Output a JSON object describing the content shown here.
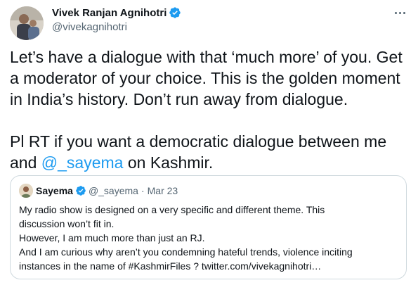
{
  "author": {
    "name": "Vivek Ranjan Agnihotri",
    "handle": "@vivekagnihotri",
    "verified_icon": "verified-badge-icon"
  },
  "more_icon": "more-options-icon",
  "tweet": {
    "paragraph1": "Let’s have a dialogue with that ‘much more’ of you. Get a moderator of your choice. This is the golden moment in India’s history. Don’t run away from dialogue.",
    "paragraph2_prefix": "Pl RT if you want a democratic dialogue between me and ",
    "mention": "@_sayema",
    "paragraph2_suffix": " on Kashmir."
  },
  "quoted": {
    "name": "Sayema",
    "handle": "@_sayema",
    "separator": "·",
    "date": "Mar 23",
    "lines": [
      "My radio show is designed on a very specific and different theme. This",
      "discussion won’t fit in.",
      "However, I am much more than just an RJ.",
      "And I am curious why aren’t you condemning hateful trends, violence inciting",
      "instances in the name of #KashmirFiles ? twitter.com/vivekagnihotri…"
    ]
  },
  "colors": {
    "link": "#1d9bf0",
    "secondary_text": "#536471",
    "border": "#cfd9de",
    "verified": "#1d9bf0"
  }
}
